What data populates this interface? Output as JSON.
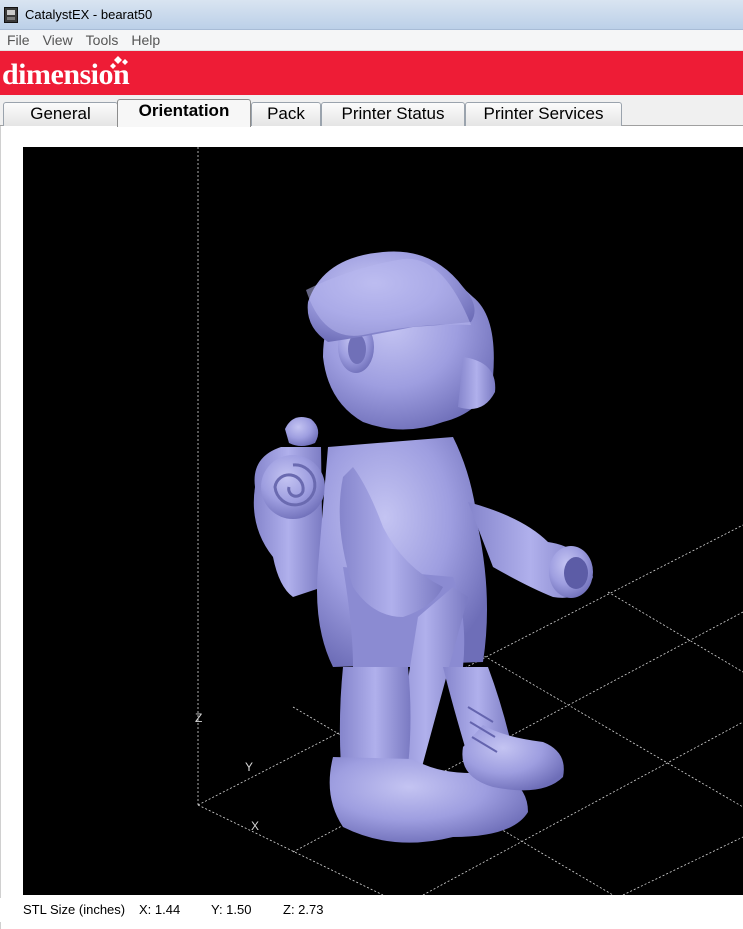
{
  "window": {
    "title": "CatalystEX - bearat50",
    "icon": "printer-app-icon"
  },
  "menu": {
    "items": [
      "File",
      "View",
      "Tools",
      "Help"
    ]
  },
  "brand": {
    "logo": "dimension",
    "color": "#ee1c36"
  },
  "tabs": [
    {
      "label": "General",
      "active": false
    },
    {
      "label": "Orientation",
      "active": true
    },
    {
      "label": "Pack",
      "active": false
    },
    {
      "label": "Printer Status",
      "active": false
    },
    {
      "label": "Printer Services",
      "active": false
    }
  ],
  "viewport": {
    "background": "#000000",
    "model_color": "#9e9ee0",
    "grid_color": "#d0d0d0",
    "axes": {
      "z": "Z",
      "y": "Y",
      "x": "X"
    }
  },
  "status": {
    "label": "STL Size (inches)",
    "x": "X: 1.44",
    "y": "Y: 1.50",
    "z": "Z: 2.73"
  }
}
